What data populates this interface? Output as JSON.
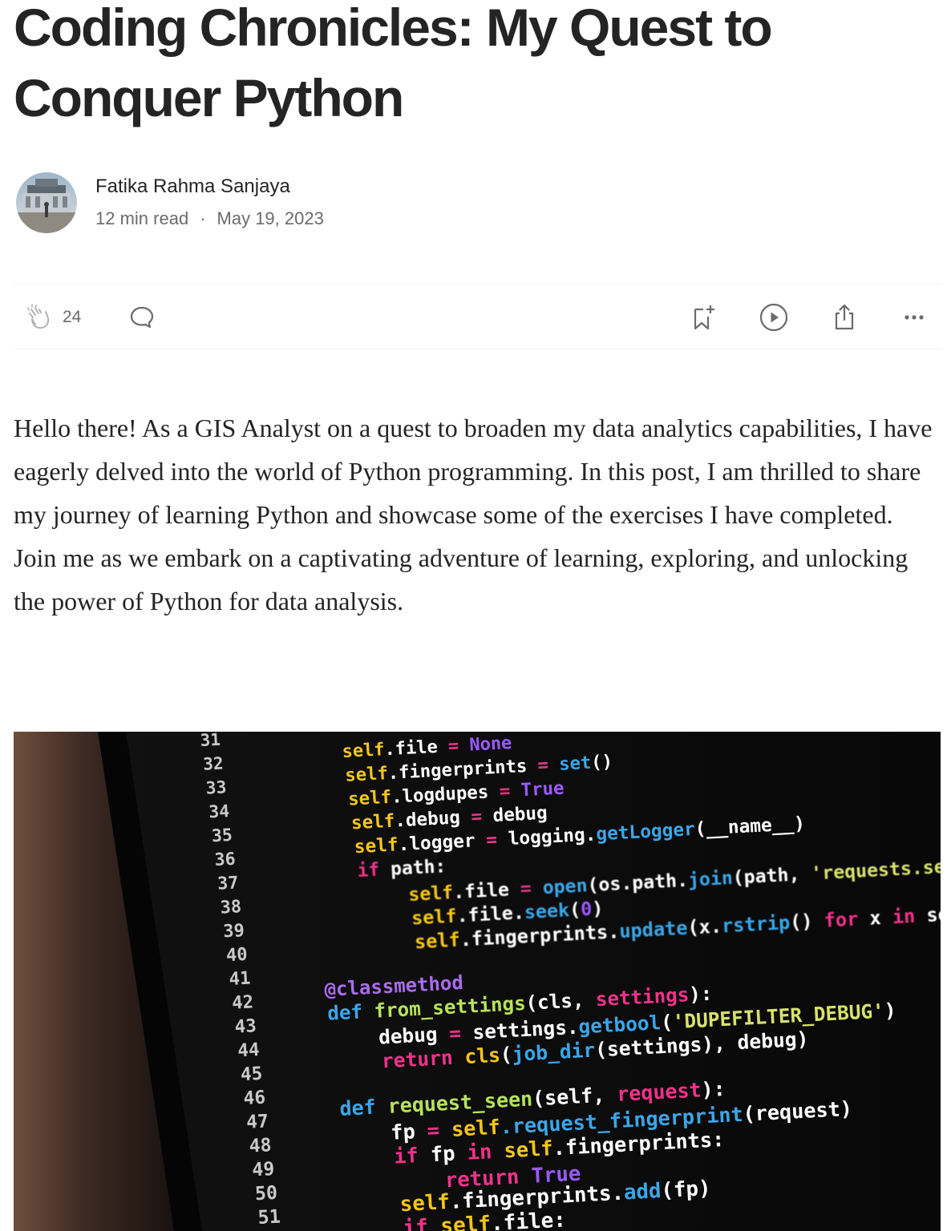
{
  "article": {
    "title": "Coding Chronicles: My Quest to Conquer Python",
    "author": {
      "name": "Fatika Rahma Sanjaya",
      "read_time": "12 min read",
      "separator": "·",
      "date": "May 19, 2023"
    },
    "actions": {
      "clap_count": "24",
      "icons": [
        "clap-icon",
        "comment-icon",
        "bookmark-add-icon",
        "play-icon",
        "share-icon",
        "more-icon"
      ]
    },
    "body": "Hello there! As a GIS Analyst on a quest to broaden my data analytics capabilities, I have eagerly delved into the world of Python programming. In this post, I am thrilled to share my journey of learning Python and showcase some of the exercises I have completed. Join me as we embark on a captivating adventure of learning, exploring, and unlocking the power of Python for data analysis."
  },
  "hero_image": {
    "line_numbers": [
      "31",
      "32",
      "33",
      "34",
      "35",
      "36",
      "37",
      "38",
      "39",
      "40",
      "41",
      "42",
      "43",
      "44",
      "45",
      "46",
      "47",
      "48",
      "49",
      "50",
      "51"
    ],
    "code_lines": [
      {
        "parts": [
          [
            "self",
            "#f5c518"
          ],
          [
            ".file",
            "#ffffff"
          ],
          [
            " = ",
            "#f0328a"
          ],
          [
            "None",
            "#9b59ff"
          ]
        ]
      },
      {
        "parts": [
          [
            "self",
            "#f5c518"
          ],
          [
            ".fingerprints",
            "#ffffff"
          ],
          [
            " = ",
            "#f0328a"
          ],
          [
            "set",
            "#3aa6e8"
          ],
          [
            "()",
            "#ffffff"
          ]
        ]
      },
      {
        "parts": [
          [
            "self",
            "#f5c518"
          ],
          [
            ".logdupes",
            "#ffffff"
          ],
          [
            " = ",
            "#f0328a"
          ],
          [
            "True",
            "#9b59ff"
          ]
        ]
      },
      {
        "parts": [
          [
            "self",
            "#f5c518"
          ],
          [
            ".debug",
            "#ffffff"
          ],
          [
            " = ",
            "#f0328a"
          ],
          [
            "debug",
            "#ffffff"
          ]
        ]
      },
      {
        "parts": [
          [
            "self",
            "#f5c518"
          ],
          [
            ".logger",
            "#ffffff"
          ],
          [
            " = ",
            "#f0328a"
          ],
          [
            "logging.",
            "#ffffff"
          ],
          [
            "getLogger",
            "#3aa6e8"
          ],
          [
            "(__name__)",
            "#ffffff"
          ]
        ]
      },
      {
        "parts": [
          [
            "if ",
            "#f0328a"
          ],
          [
            "path:",
            "#ffffff"
          ]
        ]
      },
      {
        "parts": [
          [
            "self",
            "#f5c518"
          ],
          [
            ".file",
            "#ffffff"
          ],
          [
            " = ",
            "#f0328a"
          ],
          [
            "open",
            "#3aa6e8"
          ],
          [
            "(os.path.",
            "#ffffff"
          ],
          [
            "join",
            "#3aa6e8"
          ],
          [
            "(path, ",
            "#ffffff"
          ],
          [
            "'requests.seen'",
            "#d8e26a"
          ],
          [
            "), ",
            "#ffffff"
          ]
        ]
      },
      {
        "parts": [
          [
            "self",
            "#f5c518"
          ],
          [
            ".file.",
            "#ffffff"
          ],
          [
            "seek",
            "#3aa6e8"
          ],
          [
            "(",
            "#ffffff"
          ],
          [
            "0",
            "#9b59ff"
          ],
          [
            ")",
            "#ffffff"
          ]
        ]
      },
      {
        "parts": [
          [
            "self",
            "#f5c518"
          ],
          [
            ".fingerprints.",
            "#ffffff"
          ],
          [
            "update",
            "#3aa6e8"
          ],
          [
            "(x.",
            "#ffffff"
          ],
          [
            "rstrip",
            "#3aa6e8"
          ],
          [
            "() ",
            "#ffffff"
          ],
          [
            "for ",
            "#f0328a"
          ],
          [
            "x ",
            "#ffffff"
          ],
          [
            "in ",
            "#f0328a"
          ],
          [
            "self.file",
            "#ffffff"
          ]
        ]
      },
      {
        "parts": []
      },
      {
        "parts": [
          [
            "@classmethod",
            "#a96cf0"
          ]
        ]
      },
      {
        "parts": [
          [
            "def ",
            "#3aa6e8"
          ],
          [
            "from_settings",
            "#b6e35a"
          ],
          [
            "(cls, ",
            "#ffffff"
          ],
          [
            "settings",
            "#f0328a"
          ],
          [
            "):",
            "#ffffff"
          ]
        ]
      },
      {
        "parts": [
          [
            "debug",
            "#ffffff"
          ],
          [
            " = ",
            "#f0328a"
          ],
          [
            "settings.",
            "#ffffff"
          ],
          [
            "getbool",
            "#3aa6e8"
          ],
          [
            "(",
            "#ffffff"
          ],
          [
            "'DUPEFILTER_DEBUG'",
            "#d8e26a"
          ],
          [
            ")",
            "#ffffff"
          ]
        ]
      },
      {
        "parts": [
          [
            "return ",
            "#f0328a"
          ],
          [
            "cls",
            "#f5c518"
          ],
          [
            "(",
            "#ffffff"
          ],
          [
            "job_dir",
            "#3aa6e8"
          ],
          [
            "(settings), debug)",
            "#ffffff"
          ]
        ]
      },
      {
        "parts": []
      },
      {
        "parts": [
          [
            "def ",
            "#3aa6e8"
          ],
          [
            "request_seen",
            "#b6e35a"
          ],
          [
            "(self, ",
            "#ffffff"
          ],
          [
            "request",
            "#f0328a"
          ],
          [
            "):",
            "#ffffff"
          ]
        ]
      },
      {
        "parts": [
          [
            "fp",
            "#ffffff"
          ],
          [
            " = ",
            "#f0328a"
          ],
          [
            "self",
            "#f5c518"
          ],
          [
            ".request_fingerprint",
            "#3aa6e8"
          ],
          [
            "(request)",
            "#ffffff"
          ]
        ]
      },
      {
        "parts": [
          [
            "if ",
            "#f0328a"
          ],
          [
            "fp ",
            "#ffffff"
          ],
          [
            "in ",
            "#f0328a"
          ],
          [
            "self",
            "#f5c518"
          ],
          [
            ".fingerprints:",
            "#ffffff"
          ]
        ]
      },
      {
        "parts": [
          [
            "return ",
            "#f0328a"
          ],
          [
            "True",
            "#9b59ff"
          ]
        ]
      },
      {
        "parts": [
          [
            "self",
            "#f5c518"
          ],
          [
            ".fingerprints.",
            "#ffffff"
          ],
          [
            "add",
            "#3aa6e8"
          ],
          [
            "(fp)",
            "#ffffff"
          ]
        ]
      },
      {
        "parts": [
          [
            "if ",
            "#f0328a"
          ],
          [
            "self",
            "#f5c518"
          ],
          [
            ".file:",
            "#ffffff"
          ]
        ]
      }
    ],
    "colors": {
      "line_number": "#c9c9c9",
      "background": "#0d0d0d"
    }
  }
}
